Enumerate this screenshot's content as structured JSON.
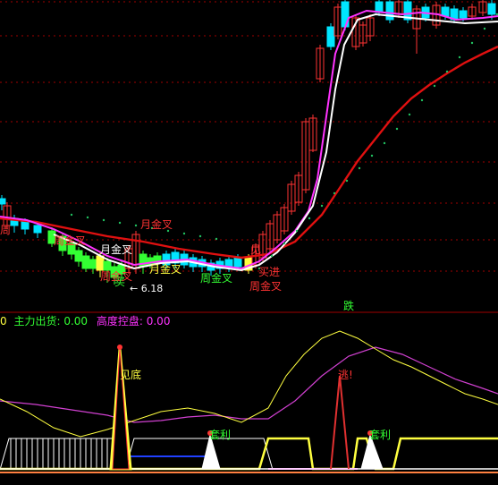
{
  "colors": {
    "background": "#000000",
    "grid": "#a00000",
    "up_candle": "#ff3333",
    "down_candle": "#00e5ff",
    "green_candle": "#33ff33",
    "ma_red": "#e01010",
    "ma_white": "#ffffff",
    "ma_magenta": "#ff33ff",
    "dots": "#20c060",
    "osc_yellow": "#ffff40",
    "osc_magenta": "#d040d0",
    "signal_red": "#e03030",
    "blue": "#2040ff",
    "white": "#ffffff"
  },
  "main_chart": {
    "annotations": [
      {
        "text": "月金叉",
        "color": "#ff3333"
      },
      {
        "text": "月金叉",
        "color": "#ffffff"
      },
      {
        "text": "月金叉",
        "color": "#ffff40"
      },
      {
        "text": "周金叉",
        "color": "#ff3333"
      },
      {
        "text": "周金叉",
        "color": "#33ff33"
      },
      {
        "text": "周金叉",
        "color": "#ff3333"
      },
      {
        "text": "周金叉",
        "color": "#ff3333"
      },
      {
        "text": "买进",
        "color": "#ff3333"
      },
      {
        "text": "见",
        "color": "#ff3333"
      },
      {
        "text": "周",
        "color": "#ff3333"
      },
      {
        "text": "买",
        "color": "#33ff33"
      },
      {
        "text": "跌",
        "color": "#33ff33"
      }
    ],
    "low_marker": "6.18"
  },
  "indicator_header": {
    "prefix": "0",
    "item1": "主力出货: 0.00",
    "item2": "高度控盘: 0.00"
  },
  "indicator_panel": {
    "labels": [
      {
        "text": "见底",
        "color": "#ffff40"
      },
      {
        "text": "套利",
        "color": "#33ff33"
      },
      {
        "text": "逃!",
        "color": "#ff3333"
      },
      {
        "text": "套利",
        "color": "#33ff33"
      }
    ]
  }
}
